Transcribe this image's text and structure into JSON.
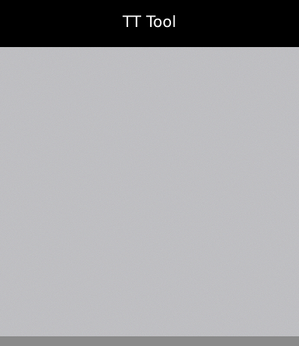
{
  "window": {
    "title": "TT Tool"
  },
  "canvas": {
    "content": "noise",
    "base_color": "#85858a"
  },
  "colors": {
    "title_bar": "#000000",
    "title_text": "#ffffff",
    "bottom_strip": "#8a8a8a"
  }
}
